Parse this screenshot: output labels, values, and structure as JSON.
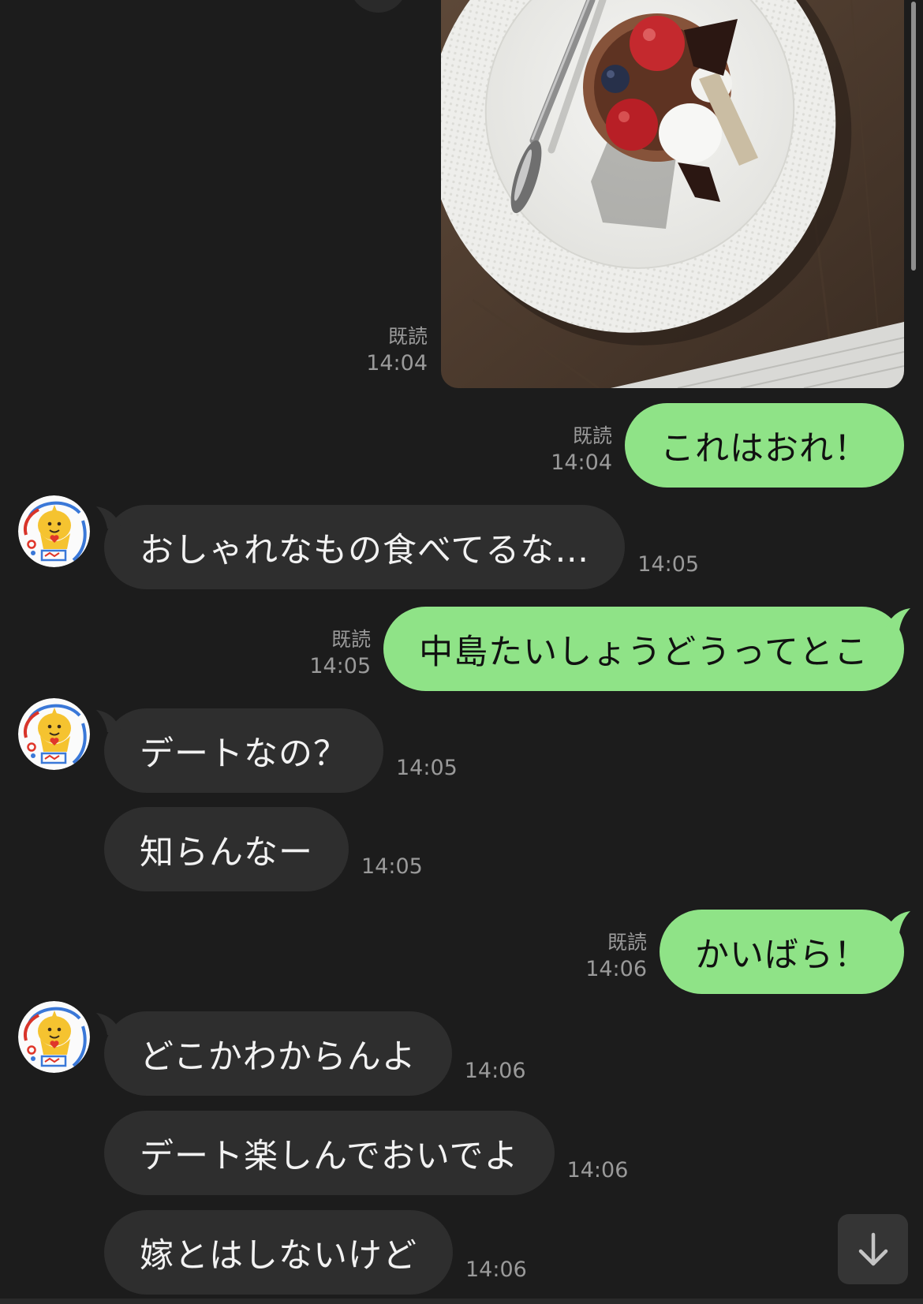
{
  "chat": {
    "colors": {
      "background": "#1c1c1c",
      "outgoing_bubble": "#8fe387",
      "incoming_bubble": "#2e2e2e",
      "meta_text": "#9a9a9a",
      "scroll_button": "#353535"
    },
    "messages": [
      {
        "outgoing": true,
        "image": true,
        "read": "既読",
        "time": "14:04"
      },
      {
        "outgoing": true,
        "text": "これはおれ！",
        "read": "既読",
        "time": "14:04"
      },
      {
        "outgoing": false,
        "text": "おしゃれなもの食べてるな…",
        "time": "14:05"
      },
      {
        "outgoing": true,
        "text": "中島たいしょうどうってとこ",
        "read": "既読",
        "time": "14:05"
      },
      {
        "outgoing": false,
        "text": "デートなの？",
        "time": "14:05"
      },
      {
        "outgoing": false,
        "text": "知らんなー",
        "time": "14:05"
      },
      {
        "outgoing": true,
        "text": "かいばら！",
        "read": "既読",
        "time": "14:06"
      },
      {
        "outgoing": false,
        "text": "どこかわからんよ",
        "time": "14:06"
      },
      {
        "outgoing": false,
        "text": "デート楽しんでおいでよ",
        "time": "14:06"
      },
      {
        "outgoing": false,
        "text": "嫁とはしないけど",
        "time": "14:06"
      }
    ]
  },
  "icons": {
    "scroll_to_bottom": "arrow-down-icon",
    "avatar": "avatar-icon"
  }
}
